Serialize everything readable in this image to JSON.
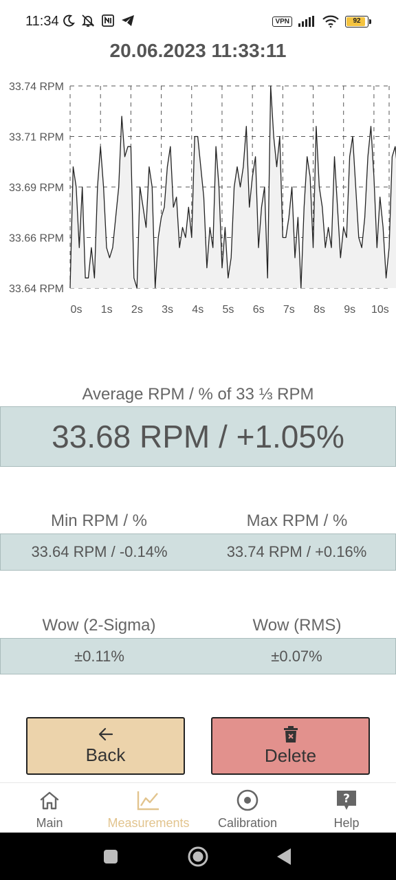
{
  "status_bar": {
    "time": "11:34",
    "left_icons": [
      "moon-icon",
      "bell-off-icon",
      "nfc-icon",
      "telegram-icon"
    ],
    "vpn_label": "VPN",
    "battery_level": "92",
    "right_icons": [
      "signal-icon",
      "wifi-icon",
      "battery-icon"
    ]
  },
  "header": {
    "title": "20.06.2023 11:33:11"
  },
  "chart_data": {
    "type": "area",
    "title": "",
    "xlabel": "",
    "ylabel": "",
    "x_ticks": [
      "0s",
      "1s",
      "2s",
      "3s",
      "4s",
      "5s",
      "6s",
      "7s",
      "8s",
      "9s",
      "10s"
    ],
    "y_ticks": [
      "33.74 RPM",
      "33.71 RPM",
      "33.69 RPM",
      "33.66 RPM",
      "33.64 RPM"
    ],
    "ylim": [
      33.64,
      33.74
    ],
    "xlim": [
      0,
      10.5
    ],
    "grid": true,
    "x_step": 0.1,
    "series": [
      {
        "values": [
          33.64,
          33.7,
          33.69,
          33.66,
          33.69,
          33.645,
          33.645,
          33.66,
          33.645,
          33.69,
          33.71,
          33.69,
          33.66,
          33.655,
          33.66,
          33.675,
          33.69,
          33.725,
          33.705,
          33.71,
          33.71,
          33.645,
          33.64,
          33.69,
          33.68,
          33.67,
          33.7,
          33.69,
          33.64,
          33.665,
          33.675,
          33.68,
          33.7,
          33.71,
          33.68,
          33.685,
          33.66,
          33.67,
          33.665,
          33.68,
          33.665,
          33.715,
          33.715,
          33.7,
          33.685,
          33.65,
          33.67,
          33.66,
          33.71,
          33.69,
          33.65,
          33.67,
          33.645,
          33.655,
          33.69,
          33.7,
          33.69,
          33.7,
          33.72,
          33.68,
          33.695,
          33.705,
          33.66,
          33.68,
          33.69,
          33.645,
          33.74,
          33.715,
          33.7,
          33.715,
          33.665,
          33.665,
          33.675,
          33.69,
          33.655,
          33.675,
          33.64,
          33.68,
          33.705,
          33.695,
          33.66,
          33.72,
          33.69,
          33.68,
          33.66,
          33.67,
          33.66,
          33.705,
          33.68,
          33.655,
          33.67,
          33.665,
          33.705,
          33.715,
          33.69,
          33.665,
          33.66,
          33.675,
          33.705,
          33.72,
          33.695,
          33.66,
          33.685,
          33.67,
          33.645,
          33.66,
          33.705,
          33.71,
          33.695,
          33.68,
          33.665,
          33.665,
          33.7,
          33.715,
          33.69,
          33.675,
          33.655,
          33.665,
          33.665,
          33.69,
          33.71,
          33.725,
          33.68,
          33.695,
          33.67,
          33.68,
          33.705,
          33.685,
          33.67,
          33.65,
          33.69,
          33.665,
          33.66,
          33.68,
          33.72,
          33.685
        ],
        "color": "#222222",
        "fill": "#f1f1f1"
      }
    ]
  },
  "average": {
    "label": "Average RPM / % of 33 ⅓ RPM",
    "value": "33.68 RPM / +1.05%"
  },
  "minmax": {
    "min_label": "Min RPM / %",
    "max_label": "Max RPM / %",
    "min_value": "33.64 RPM / -0.14%",
    "max_value": "33.74 RPM / +0.16%"
  },
  "wow": {
    "sigma_label": "Wow (2-Sigma)",
    "rms_label": "Wow (RMS)",
    "sigma_value": "±0.11%",
    "rms_value": "±0.07%"
  },
  "buttons": {
    "back_label": "Back",
    "back_icon": "arrow-left-icon",
    "back_color": "#ecd3ab",
    "delete_label": "Delete",
    "delete_icon": "trash-icon",
    "delete_color": "#e2918d"
  },
  "bottom_nav": {
    "items": [
      {
        "label": "Main",
        "icon": "home-icon",
        "active": false
      },
      {
        "label": "Measurements",
        "icon": "chart-line-icon",
        "active": true
      },
      {
        "label": "Calibration",
        "icon": "target-icon",
        "active": false
      },
      {
        "label": "Help",
        "icon": "help-icon",
        "active": false
      }
    ],
    "active_color": "#e2c48e",
    "inactive_color": "#666666"
  }
}
